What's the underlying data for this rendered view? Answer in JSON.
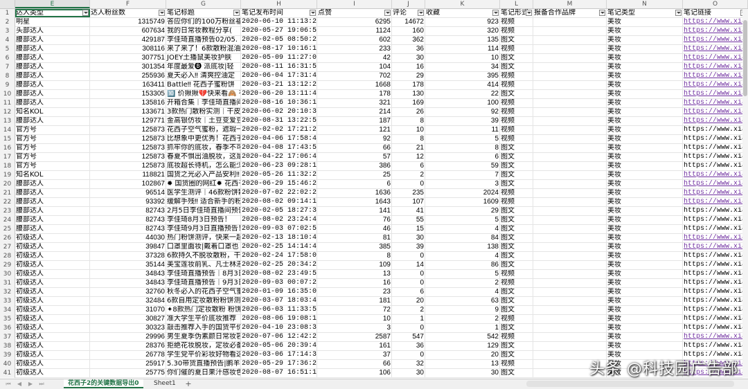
{
  "columns": [
    "E",
    "F",
    "G",
    "H",
    "I",
    "J",
    "K",
    "L",
    "M",
    "N",
    "O"
  ],
  "selected_column": "E",
  "header_row": {
    "num": "1",
    "cells": [
      "达人类型",
      "达人粉丝数",
      "笔记标题",
      "笔记发布时间",
      "点赞",
      "评论",
      "收藏",
      "笔记形式",
      "报备合作品牌",
      "笔记类型",
      "笔记链接"
    ]
  },
  "rows": [
    {
      "num": "2",
      "type": "明星",
      "fans": "1315749",
      "title": "答应你们的100万粉丝福",
      "time": "2020-06-10 11:13:24",
      "likes": "6295",
      "comments": "14672",
      "fav": "923",
      "form": "视频",
      "brand": "",
      "ntype": "美妆",
      "link": "https://www.xia",
      "visited": true
    },
    {
      "num": "3",
      "type": "头部达人",
      "fans": "607634",
      "title": "我的日常妆教程分享(",
      "time": "2020-05-27 19:06:54",
      "likes": "1124",
      "comments": "160",
      "fav": "320",
      "form": "视频",
      "brand": "",
      "ntype": "美妆",
      "link": "https://www.xia",
      "visited": true
    },
    {
      "num": "4",
      "type": "腰部达人",
      "fans": "429187",
      "title": "李佳琦直播预告02/05.",
      "time": "2020-02-05 08:50:24",
      "likes": "602",
      "comments": "362",
      "fav": "135",
      "form": "图文",
      "brand": "",
      "ntype": "美妆",
      "link": "https://www.xia",
      "visited": true
    },
    {
      "num": "5",
      "type": "腰部达人",
      "fans": "308116",
      "title": "来了来了！6款散粉混油",
      "time": "2020-08-17 10:16:17",
      "likes": "233",
      "comments": "36",
      "fav": "114",
      "form": "视频",
      "brand": "",
      "ntype": "美妆",
      "link": "https://www.xia",
      "visited": true
    },
    {
      "num": "6",
      "type": "腰部达人",
      "fans": "307751",
      "title": "JOEY土播鼠美妆护肤",
      "time": "2020-05-09 11:27:03",
      "likes": "42",
      "comments": "30",
      "fav": "10",
      "form": "图文",
      "brand": "",
      "ntype": "美妆",
      "link": "https://www.xia",
      "visited": true
    },
    {
      "num": "7",
      "type": "腰部达人",
      "fans": "301354",
      "title": "年度最爱🅑 派底妆|轻",
      "time": "2020-08-11 16:31:55",
      "likes": "104",
      "comments": "16",
      "fav": "34",
      "form": "图文",
      "brand": "",
      "ntype": "美妆",
      "link": "https://www.xia",
      "visited": true
    },
    {
      "num": "8",
      "type": "腰部达人",
      "fans": "255936",
      "title": "夏天必入‼ 清爽控油定",
      "time": "2020-06-04 17:31:47",
      "likes": "702",
      "comments": "29",
      "fav": "395",
      "form": "视频",
      "brand": "",
      "ntype": "美妆",
      "link": "https://www.xia",
      "visited": true
    },
    {
      "num": "9",
      "type": "腰部达人",
      "fans": "163411",
      "title": "Battle‼ 花西子蜜粉饼",
      "time": "2020-03-21 13:12:28",
      "likes": "1668",
      "comments": "178",
      "fav": "414",
      "form": "视频",
      "brand": "",
      "ntype": "美妆",
      "link": "https://www.xia",
      "visited": true
    },
    {
      "num": "10",
      "type": "腰部达人",
      "fans": "153305",
      "title": "🔟 价揪揪💔快来看🙈 有",
      "time": "2020-06-20 13:11:49",
      "likes": "178",
      "comments": "130",
      "fav": "22",
      "form": "图文",
      "brand": "",
      "ntype": "美妆",
      "link": "https://www.xia",
      "visited": true
    },
    {
      "num": "11",
      "type": "腰部达人",
      "fans": "135816",
      "title": "开箱合集｜李佳琦直播间",
      "time": "2020-08-16 10:36:19",
      "likes": "321",
      "comments": "169",
      "fav": "100",
      "form": "视频",
      "brand": "",
      "ntype": "美妆",
      "link": "https://www.xia",
      "visited": true
    },
    {
      "num": "12",
      "type": "知名KOL",
      "fans": "133671",
      "title": "3款热门散粉实测｜干皮",
      "time": "2020-06-02 20:10:33",
      "likes": "214",
      "comments": "26",
      "fav": "92",
      "form": "视频",
      "brand": "",
      "ntype": "美妆",
      "link": "https://www.xia",
      "visited": true
    },
    {
      "num": "13",
      "type": "腰部达人",
      "fans": "129771",
      "title": "金高银仿妆｜土豆变爱豆",
      "time": "2020-08-31 13:22:57",
      "likes": "187",
      "comments": "8",
      "fav": "39",
      "form": "视频",
      "brand": "",
      "ntype": "美妆",
      "link": "https://www.xia",
      "visited": true
    },
    {
      "num": "14",
      "type": "官方号",
      "fans": "125873",
      "title": "花西子空气蜜粉，遮瑕一",
      "time": "2020-02-02 17:21:28",
      "likes": "121",
      "comments": "10",
      "fav": "11",
      "form": "视频",
      "brand": "",
      "ntype": "美妆",
      "link": "https://www.xiaoh",
      "visited": false
    },
    {
      "num": "15",
      "type": "官方号",
      "fans": "125873",
      "title": "比想象中更优秀！花西子",
      "time": "2020-04-06 17:58:44",
      "likes": "92",
      "comments": "8",
      "fav": "5",
      "form": "视频",
      "brand": "",
      "ntype": "美妆",
      "link": "https://www.xiaoh",
      "visited": false
    },
    {
      "num": "16",
      "type": "官方号",
      "fans": "125873",
      "title": "抓牢你的底妆，春季不可",
      "time": "2020-04-08 17:43:53",
      "likes": "66",
      "comments": "21",
      "fav": "8",
      "form": "图文",
      "brand": "",
      "ntype": "美妆",
      "link": "https://www.xiaoh",
      "visited": false
    },
    {
      "num": "17",
      "type": "官方号",
      "fans": "125873",
      "title": "春夏不惧出油脱妆，这是",
      "time": "2020-04-22 17:06:46",
      "likes": "57",
      "comments": "12",
      "fav": "6",
      "form": "图文",
      "brand": "",
      "ntype": "美妆",
      "link": "https://www.xiaoh",
      "visited": false
    },
    {
      "num": "18",
      "type": "官方号",
      "fans": "125873",
      "title": "底妆超长待机，怎么能少",
      "time": "2020-06-23 09:28:13",
      "likes": "386",
      "comments": "6",
      "fav": "59",
      "form": "图文",
      "brand": "",
      "ntype": "美妆",
      "link": "https://www.xiaoh",
      "visited": false
    },
    {
      "num": "19",
      "type": "知名KOL",
      "fans": "118821",
      "title": "国货之光必入产品安利‼",
      "time": "2020-05-26 11:32:22",
      "likes": "25",
      "comments": "2",
      "fav": "7",
      "form": "图文",
      "brand": "",
      "ntype": "美妆",
      "link": "https://www.xia",
      "visited": true
    },
    {
      "num": "20",
      "type": "腰部达人",
      "fans": "102867",
      "title": "✹ 国货圈的网红✹ 花西子",
      "time": "2020-06-29 15:46:28",
      "likes": "6",
      "comments": "0",
      "fav": "3",
      "form": "图文",
      "brand": "",
      "ntype": "美妆",
      "link": "https://www.xia",
      "visited": true
    },
    {
      "num": "21",
      "type": "腰部达人",
      "fans": "96514",
      "title": "医学生测评｜46款粉饼散",
      "time": "2020-07-02 22:02:25",
      "likes": "1636",
      "comments": "235",
      "fav": "2024",
      "form": "视频",
      "brand": "",
      "ntype": "美妆",
      "link": "https://www.xia",
      "visited": true
    },
    {
      "num": "22",
      "type": "腰部达人",
      "fans": "93392",
      "title": "缓解手残‼ 适合新手的粉",
      "time": "2020-08-02 09:14:11",
      "likes": "1643",
      "comments": "107",
      "fav": "1609",
      "form": "视频",
      "brand": "",
      "ntype": "美妆",
      "link": "https://www.xia",
      "visited": true
    },
    {
      "num": "23",
      "type": "腰部达人",
      "fans": "82743",
      "title": "2月5日李佳琦直播间预告",
      "time": "2020-02-05 18:27:34",
      "likes": "141",
      "comments": "41",
      "fav": "29",
      "form": "图文",
      "brand": "",
      "ntype": "美妆",
      "link": "https://www.xiaoh",
      "visited": false
    },
    {
      "num": "24",
      "type": "腰部达人",
      "fans": "82743",
      "title": "李佳琦8月3日预告！",
      "time": "2020-08-02 23:24:40",
      "likes": "76",
      "comments": "55",
      "fav": "5",
      "form": "图文",
      "brand": "",
      "ntype": "美妆",
      "link": "https://www.xiaoh",
      "visited": false
    },
    {
      "num": "25",
      "type": "腰部达人",
      "fans": "82743",
      "title": "李佳琦9月3日直播预告！",
      "time": "2020-09-03 07:02:55",
      "likes": "46",
      "comments": "15",
      "fav": "4",
      "form": "图文",
      "brand": "",
      "ntype": "美妆",
      "link": "https://www.xiaoh",
      "visited": false
    },
    {
      "num": "26",
      "type": "初级达人",
      "fans": "44030",
      "title": "热门粉饼测评，快来一起",
      "time": "2020-02-13 18:10:48",
      "likes": "81",
      "comments": "30",
      "fav": "84",
      "form": "图文",
      "brand": "",
      "ntype": "美妆",
      "link": "https://www.xia",
      "visited": true
    },
    {
      "num": "27",
      "type": "初级达人",
      "fans": "39847",
      "title": "口罩里面妆|戴着口罩也",
      "time": "2020-02-25 14:14:47",
      "likes": "385",
      "comments": "39",
      "fav": "138",
      "form": "图文",
      "brand": "",
      "ntype": "美妆",
      "link": "https://www.xia",
      "visited": true
    },
    {
      "num": "28",
      "type": "初级达人",
      "fans": "37328",
      "title": "6款持久不脱妆散粉，干",
      "time": "2020-02-24 17:58:02",
      "likes": "8",
      "comments": "0",
      "fav": "4",
      "form": "图文",
      "brand": "",
      "ntype": "美妆",
      "link": "https://www.xiaoh",
      "visited": false
    },
    {
      "num": "29",
      "type": "初级达人",
      "fans": "35144",
      "title": "美宝莲妆前乳、凡士林液",
      "time": "2020-02-25 20:34:28",
      "likes": "109",
      "comments": "14",
      "fav": "86",
      "form": "图文",
      "brand": "",
      "ntype": "美妆",
      "link": "https://www.xiaoh",
      "visited": false
    },
    {
      "num": "30",
      "type": "初级达人",
      "fans": "34843",
      "title": "李佳琦直播预告｜8月3日",
      "time": "2020-08-02 23:49:58",
      "likes": "13",
      "comments": "0",
      "fav": "5",
      "form": "视频",
      "brand": "",
      "ntype": "美妆",
      "link": "https://www.xiaoh",
      "visited": false
    },
    {
      "num": "31",
      "type": "初级达人",
      "fans": "34843",
      "title": "李佳琦直播预告｜9月3日",
      "time": "2020-09-03 00:07:20",
      "likes": "16",
      "comments": "0",
      "fav": "2",
      "form": "视频",
      "brand": "",
      "ntype": "美妆",
      "link": "https://www.xiaoh",
      "visited": false
    },
    {
      "num": "32",
      "type": "初级达人",
      "fans": "32760",
      "title": "秋冬必入的花西子空气蜜",
      "time": "2020-01-09 16:35:02",
      "likes": "23",
      "comments": "6",
      "fav": "4",
      "form": "图文",
      "brand": "",
      "ntype": "美妆",
      "link": "https://www.xiaoh",
      "visited": false
    },
    {
      "num": "33",
      "type": "初级达人",
      "fans": "32484",
      "title": "6款自用定妆散粉粉饼测",
      "time": "2020-03-07 18:03:41",
      "likes": "181",
      "comments": "20",
      "fav": "63",
      "form": "图文",
      "brand": "",
      "ntype": "美妆",
      "link": "https://www.xiaoh",
      "visited": false
    },
    {
      "num": "34",
      "type": "初级达人",
      "fans": "31070",
      "title": "✦8款热门定妆散粉 粉饼",
      "time": "2020-06-03 11:33:55",
      "likes": "72",
      "comments": "2",
      "fav": "9",
      "form": "图文",
      "brand": "",
      "ntype": "美妆",
      "link": "https://www.xiaoh",
      "visited": false
    },
    {
      "num": "35",
      "type": "初级达人",
      "fans": "30827",
      "title": "准大学生平价底妆推荐",
      "time": "2020-08-06 19:08:13",
      "likes": "10",
      "comments": "1",
      "fav": "2",
      "form": "视频",
      "brand": "",
      "ntype": "美妆",
      "link": "https://www.xiaoh",
      "visited": false
    },
    {
      "num": "36",
      "type": "初级达人",
      "fans": "30323",
      "title": "敲击推荐入手的国货平价",
      "time": "2020-04-10 23:08:37",
      "likes": "3",
      "comments": "0",
      "fav": "1",
      "form": "图文",
      "brand": "",
      "ntype": "美妆",
      "link": "https://www.xiaoh",
      "visited": false
    },
    {
      "num": "37",
      "type": "初级达人",
      "fans": "29996",
      "title": "男生夏季伪素颜日常妆容",
      "time": "2020-07-06 12:42:25",
      "likes": "2587",
      "comments": "547",
      "fav": "542",
      "form": "视频",
      "brand": "",
      "ntype": "美妆",
      "link": "https://www.xia",
      "visited": true
    },
    {
      "num": "38",
      "type": "初级达人",
      "fans": "28376",
      "title": "拒绝花妆脱妆，定妆必备",
      "time": "2020-05-06 20:39:44",
      "likes": "161",
      "comments": "36",
      "fav": "129",
      "form": "图文",
      "brand": "",
      "ntype": "美妆",
      "link": "https://www.xiaoh",
      "visited": false
    },
    {
      "num": "39",
      "type": "初级达人",
      "fans": "26778",
      "title": "学生党平价彩妆好物看这",
      "time": "2020-03-06 17:14:33",
      "likes": "37",
      "comments": "0",
      "fav": "20",
      "form": "图文",
      "brand": "",
      "ntype": "美妆",
      "link": "https://www.xiaoh",
      "visited": false
    },
    {
      "num": "40",
      "type": "初级达人",
      "fans": "25917",
      "title": "5.30带货直播预告|鹏羊羊",
      "time": "2020-05-29 17:36:26",
      "likes": "66",
      "comments": "32",
      "fav": "13",
      "form": "视频",
      "brand": "",
      "ntype": "美妆",
      "link": "https://www.xia",
      "visited": true
    },
    {
      "num": "41",
      "type": "初级达人",
      "fans": "25775",
      "title": "你们催的夏日果汁感妆色",
      "time": "2020-08-07 16:51:13",
      "likes": "106",
      "comments": "30",
      "fav": "30",
      "form": "图文",
      "brand": "",
      "ntype": "美妆",
      "link": "https://www.xia",
      "visited": true
    }
  ],
  "sheet_tabs": [
    {
      "label": "花西子2的关键数据导出0",
      "active": true
    },
    {
      "label": "Sheet1",
      "active": false
    }
  ],
  "add_sheet_symbol": "+",
  "watermark": "头条 @科技园广告部",
  "colors": {
    "accent": "#217346",
    "link_visited": "#7030a0",
    "header_bg": "#f2f2f2"
  }
}
